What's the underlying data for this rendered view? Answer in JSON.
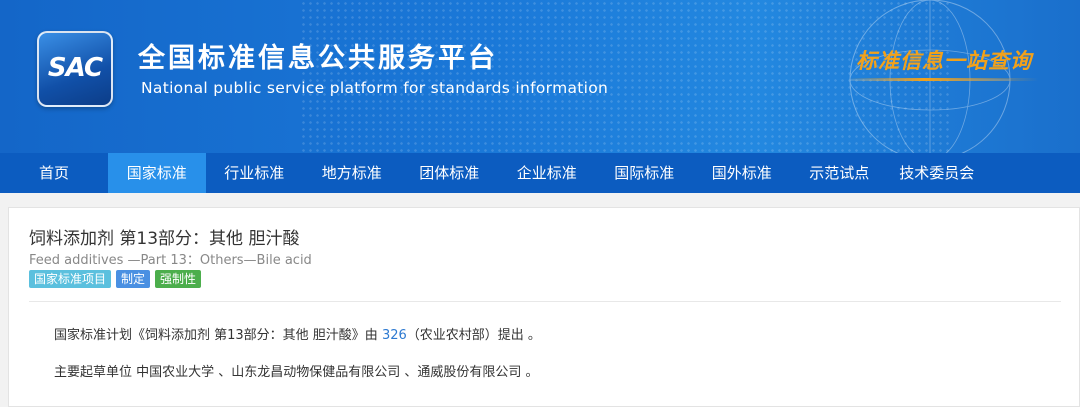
{
  "header": {
    "logo_text": "SAC",
    "title": "全国标准信息公共服务平台",
    "subtitle": "National public service platform  for standards information",
    "slogan": "标准信息一站查询",
    "accent_color": "#f2a11a"
  },
  "nav": {
    "items": [
      {
        "label": "首页"
      },
      {
        "label": "国家标准"
      },
      {
        "label": "行业标准"
      },
      {
        "label": "地方标准"
      },
      {
        "label": "团体标准"
      },
      {
        "label": "企业标准"
      },
      {
        "label": "国际标准"
      },
      {
        "label": "国外标准"
      },
      {
        "label": "示范试点"
      },
      {
        "label": "技术委员会"
      }
    ],
    "active_index": 1
  },
  "document": {
    "title": "饲料添加剂 第13部分：其他 胆汁酸",
    "title_en": "Feed additives —Part 13：Others—Bile acid",
    "tags": [
      "国家标准项目",
      "制定",
      "强制性"
    ],
    "plan_prefix": "国家标准计划《饲料添加剂 第13部分：其他 胆汁酸》由 ",
    "plan_link": "326",
    "plan_suffix": "（农业农村部）提出 。",
    "drafters": "主要起草单位 中国农业大学 、山东龙昌动物保健品有限公司 、通威股份有限公司 。"
  }
}
